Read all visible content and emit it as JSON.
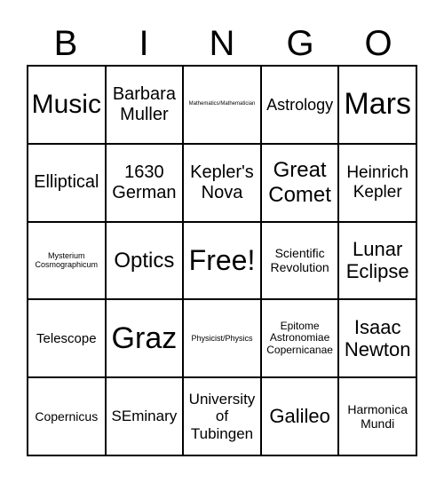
{
  "header": [
    "B",
    "I",
    "N",
    "G",
    "O"
  ],
  "cells": [
    "Music",
    "Barbara Muller",
    "Mathematics/Mathematician",
    "Astrology",
    "Mars",
    "Elliptical",
    "1630 German",
    "Kepler's Nova",
    "Great Comet",
    "Heinrich Kepler",
    "Mysterium Cosmographicum",
    "Optics",
    "Free!",
    "Scientific Revolution",
    "Lunar Eclipse",
    "Telescope",
    "Graz",
    "Physicist/Physics",
    "Epitome Astronomiae Copernicanae",
    "Isaac Newton",
    "Copernicus",
    "SEminary",
    "University of Tubingen",
    "Galileo",
    "Harmonica Mundi"
  ]
}
